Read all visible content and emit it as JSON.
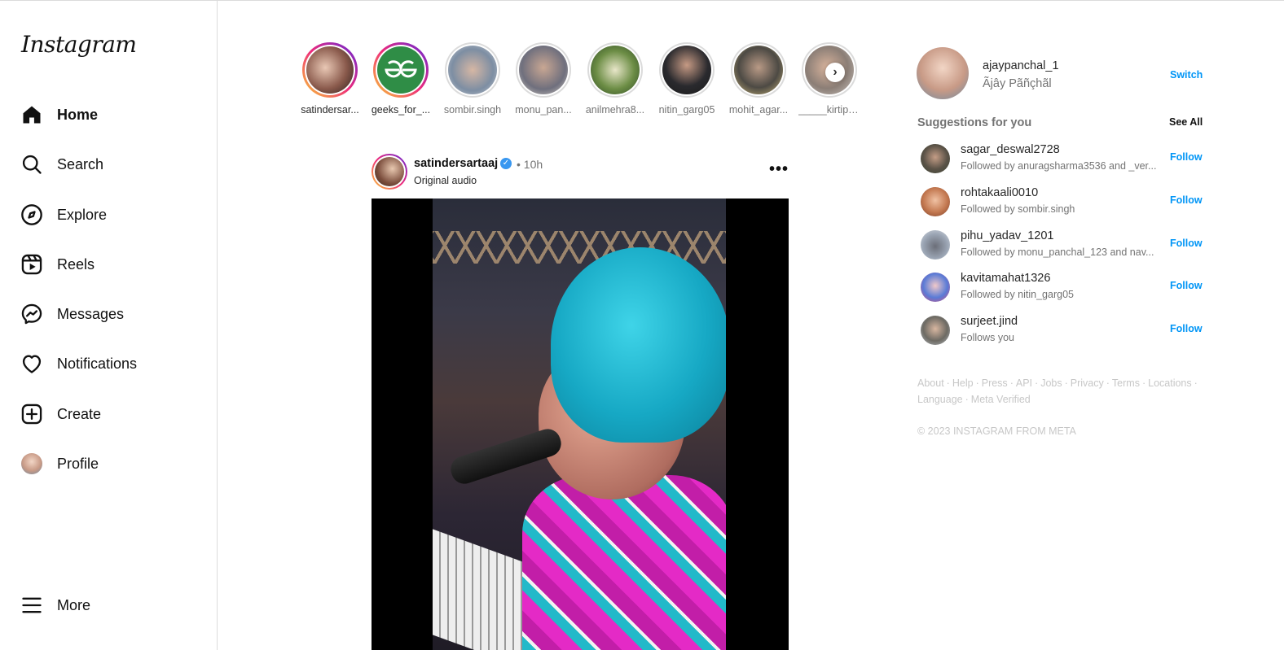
{
  "app": {
    "logo": "Instagram"
  },
  "sidebar": {
    "items": [
      {
        "label": "Home",
        "icon": "home-icon"
      },
      {
        "label": "Search",
        "icon": "search-icon"
      },
      {
        "label": "Explore",
        "icon": "compass-icon"
      },
      {
        "label": "Reels",
        "icon": "reels-icon"
      },
      {
        "label": "Messages",
        "icon": "messenger-icon"
      },
      {
        "label": "Notifications",
        "icon": "heart-icon"
      },
      {
        "label": "Create",
        "icon": "plus-square-icon"
      },
      {
        "label": "Profile",
        "icon": "avatar"
      }
    ],
    "more": {
      "label": "More",
      "icon": "menu-icon"
    }
  },
  "stories": [
    {
      "username": "satindersar...",
      "seen": false
    },
    {
      "username": "geeks_for_...",
      "seen": false
    },
    {
      "username": "sombir.singh",
      "seen": true
    },
    {
      "username": "monu_pan...",
      "seen": true
    },
    {
      "username": "anilmehra8...",
      "seen": true
    },
    {
      "username": "nitin_garg05",
      "seen": true
    },
    {
      "username": "mohit_agar...",
      "seen": true
    },
    {
      "username": "_____kirtipa...",
      "seen": true
    }
  ],
  "stories_next": "›",
  "post": {
    "username": "satindersartaaj",
    "time": "• 10h",
    "audio": "Original audio",
    "more": "•••",
    "verified": "✓"
  },
  "me": {
    "username": "ajaypanchal_1",
    "name": "Ãjây Pãñçhãl",
    "switch_label": "Switch"
  },
  "suggestions": {
    "title": "Suggestions for you",
    "see_all": "See All",
    "items": [
      {
        "username": "sagar_deswal2728",
        "sub": "Followed by anuragsharma3536 and _ver...",
        "action": "Follow"
      },
      {
        "username": "rohtakaali0010",
        "sub": "Followed by sombir.singh",
        "action": "Follow"
      },
      {
        "username": "pihu_yadav_1201",
        "sub": "Followed by monu_panchal_123 and nav...",
        "action": "Follow"
      },
      {
        "username": "kavitamahat1326",
        "sub": "Followed by nitin_garg05",
        "action": "Follow"
      },
      {
        "username": "surjeet.jind",
        "sub": "Follows you",
        "action": "Follow"
      }
    ]
  },
  "footer": {
    "links": [
      "About",
      "Help",
      "Press",
      "API",
      "Jobs",
      "Privacy",
      "Terms",
      "Locations",
      "Language",
      "Meta Verified"
    ],
    "copyright": "© 2023 INSTAGRAM FROM META"
  },
  "colors": {
    "accent": "#0095f6",
    "text": "#262626",
    "muted": "#737373"
  }
}
